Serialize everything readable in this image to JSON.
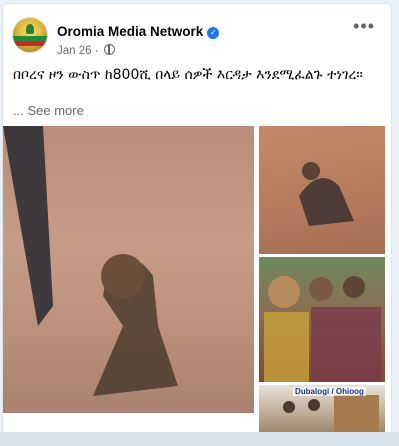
{
  "post": {
    "page_name": "Oromia Media Network",
    "date": "Jan 26",
    "separator": "·",
    "more_label": "•••",
    "text": "በቦረና ዞን ውስጥ ከ800ሺ በላይ ሰዎች እርዳታ እንደሚፈልጉ ተነገረ፡፡",
    "see_more": "See more",
    "ellipsis": "..."
  },
  "photos": {
    "caption_4": "Dubalogi / Ohioog"
  },
  "icons": {
    "verified": "verified-badge-icon",
    "globe": "globe-icon",
    "more": "more-options-icon"
  },
  "colors": {
    "brand_blue": "#1877f2",
    "meta_gray": "#65676b"
  }
}
